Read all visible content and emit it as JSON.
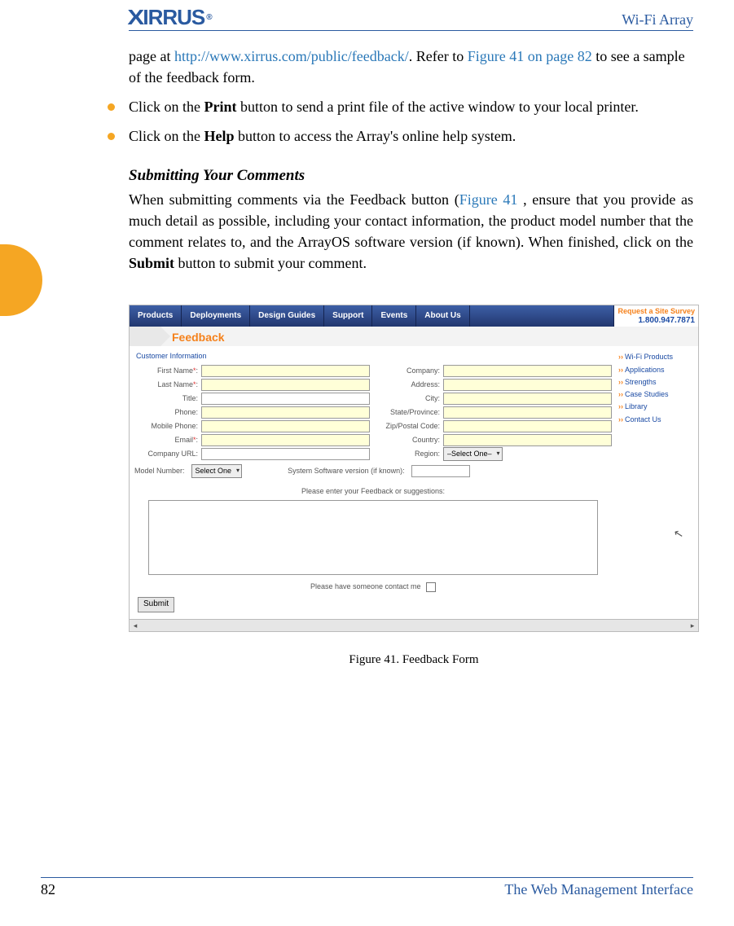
{
  "header": {
    "brand": "XIRRUS",
    "right": "Wi-Fi Array"
  },
  "intro": {
    "pre": "page at ",
    "url": "http://www.xirrus.com/public/feedback/",
    "mid": ". Refer to ",
    "figref": "Figure 41 on page 82",
    "post": " to see a sample of the feedback form."
  },
  "bullets": [
    {
      "pre": "Click on the ",
      "bold": "Print",
      "post": " button to send a print file of the active window to your local printer."
    },
    {
      "pre": "Click on the ",
      "bold": "Help",
      "post": " button to access the Array's online help system."
    }
  ],
  "subhead": "Submitting Your Comments",
  "body": {
    "pre": "When submitting comments via the Feedback button (",
    "figref": "Figure 41 ",
    "mid": ", ensure that you provide as much detail as possible, including your contact information, the product model number that the comment relates to, and the ArrayOS software version (if known). When finished, click on the ",
    "bold": "Submit",
    "post": " button to submit your comment."
  },
  "nav": {
    "items": [
      "Products",
      "Deployments",
      "Design Guides",
      "Support",
      "Events",
      "About Us"
    ],
    "request_line1": "Request a Site Survey",
    "request_line2": "1.800.947.7871"
  },
  "breadcrumb": "Feedback",
  "form": {
    "section": "Customer Information",
    "left_fields": [
      {
        "label": "First Name:",
        "required": true,
        "highlight": true
      },
      {
        "label": "Last Name:",
        "required": true,
        "highlight": true
      },
      {
        "label": "Title:",
        "required": false,
        "highlight": false
      },
      {
        "label": "Phone:",
        "required": false,
        "highlight": true
      },
      {
        "label": "Mobile Phone:",
        "required": false,
        "highlight": true
      },
      {
        "label": "Email:",
        "required": true,
        "highlight": true
      },
      {
        "label": "Company URL:",
        "required": false,
        "highlight": false
      }
    ],
    "right_fields": [
      {
        "label": "Company:",
        "highlight": true
      },
      {
        "label": "Address:",
        "highlight": true
      },
      {
        "label": "City:",
        "highlight": true
      },
      {
        "label": "State/Province:",
        "highlight": true
      },
      {
        "label": "Zip/Postal Code:",
        "highlight": true
      },
      {
        "label": "Country:",
        "highlight": true
      }
    ],
    "region_label": "Region:",
    "region_select": "–Select One–",
    "model_label": "Model Number:",
    "model_select": "Select One",
    "sw_label": "System Software version (if known):",
    "feedback_label": "Please enter your Feedback or suggestions:",
    "contact_label": "Please have someone contact me",
    "submit": "Submit"
  },
  "sidebar_links": [
    "Wi-Fi Products",
    "Applications",
    "Strengths",
    "Case Studies",
    "Library",
    "Contact Us"
  ],
  "figcaption": "Figure 41. Feedback Form",
  "footer": {
    "page": "82",
    "chapter": "The Web Management Interface"
  }
}
